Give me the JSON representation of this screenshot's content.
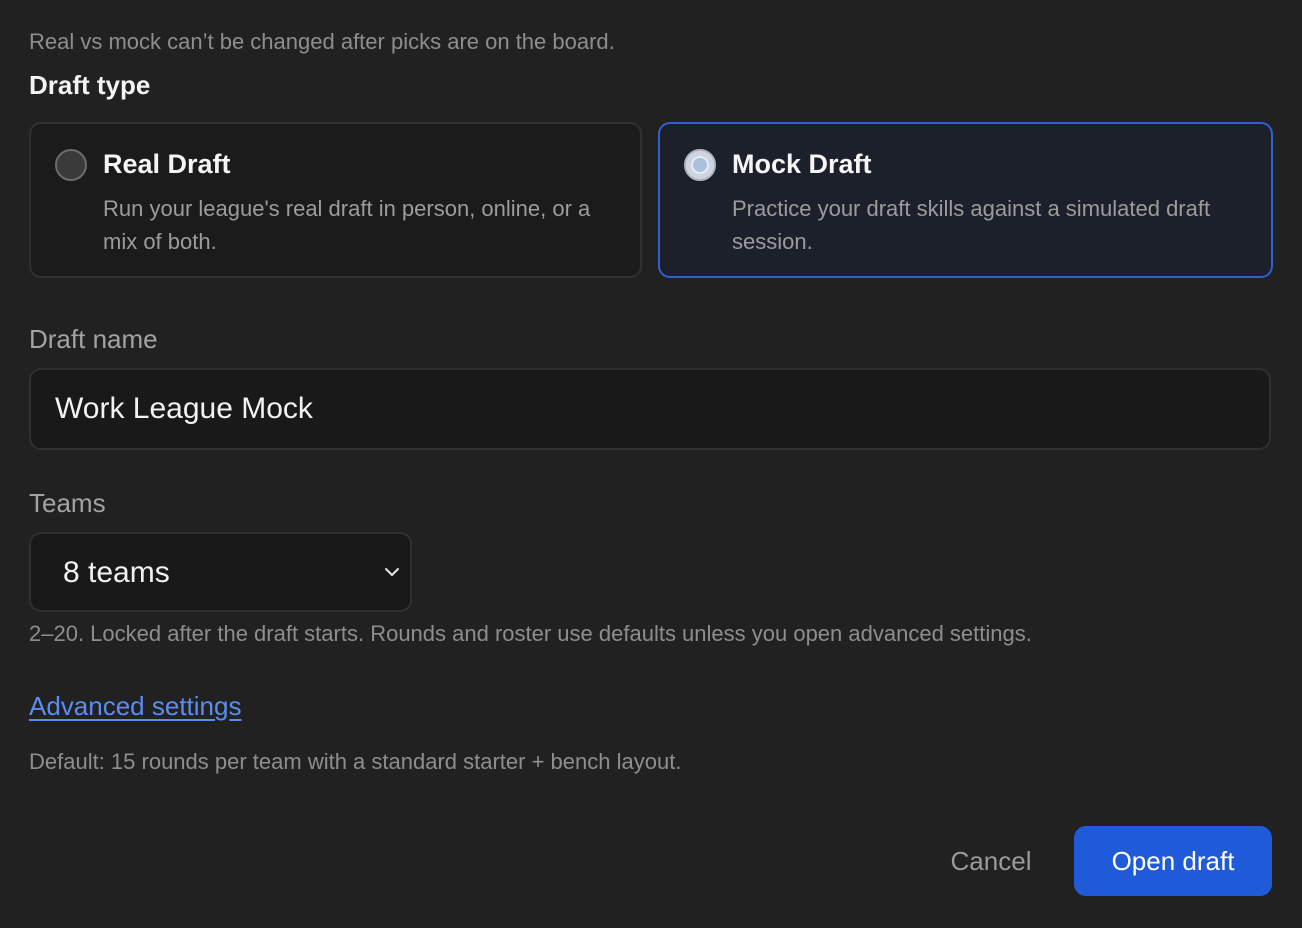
{
  "notice": "Real vs mock can’t be changed after picks are on the board.",
  "draft_type": {
    "label": "Draft type",
    "selected": "mock",
    "options": [
      {
        "id": "real",
        "title": "Real Draft",
        "description": "Run your league's real draft in person, online, or a mix of both."
      },
      {
        "id": "mock",
        "title": "Mock Draft",
        "description": "Practice your draft skills against a simulated draft session."
      }
    ]
  },
  "draft_name": {
    "label": "Draft name",
    "value": "Work League Mock"
  },
  "teams": {
    "label": "Teams",
    "selected": "8 teams",
    "hint": "2–20. Locked after the draft starts. Rounds and roster use defaults unless you open advanced settings."
  },
  "advanced": {
    "link_label": "Advanced settings",
    "default_text": "Default: 15 rounds per team with a standard starter + bench layout."
  },
  "actions": {
    "cancel_label": "Cancel",
    "submit_label": "Open draft"
  },
  "colors": {
    "background": "#212121",
    "accent": "#1f5ad8",
    "selected_border": "#2f5fd0",
    "link": "#5b8df0"
  },
  "icons": {
    "select_arrow": "chevron-down-icon"
  }
}
